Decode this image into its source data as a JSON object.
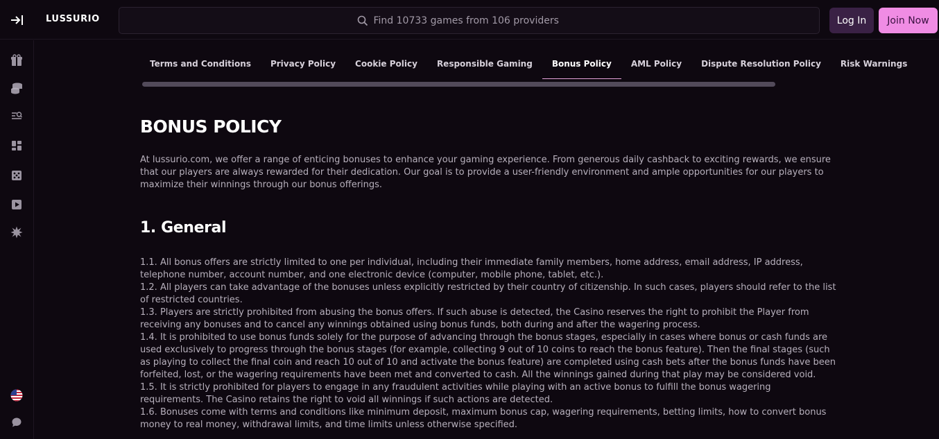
{
  "header": {
    "logo": "LUSSURIO",
    "search_placeholder": "Find 10733 games from 106 providers",
    "login_label": "Log In",
    "join_label": "Join Now"
  },
  "sidebar": {
    "icons": [
      "gift-icon",
      "coins-icon",
      "search-list-icon",
      "grid-icon",
      "dice-icon",
      "play-icon",
      "burst-icon",
      "us-flag-icon",
      "chat-icon"
    ]
  },
  "tabs": [
    {
      "label": "Terms and Conditions",
      "active": false
    },
    {
      "label": "Privacy Policy",
      "active": false
    },
    {
      "label": "Cookie Policy",
      "active": false
    },
    {
      "label": "Responsible Gaming",
      "active": false
    },
    {
      "label": "Bonus Policy",
      "active": true
    },
    {
      "label": "AML Policy",
      "active": false
    },
    {
      "label": "Dispute Resolution Policy",
      "active": false
    },
    {
      "label": "Risk Warnings",
      "active": false
    }
  ],
  "content": {
    "title": "BONUS POLICY",
    "intro": "At lussurio.com, we offer a range of enticing bonuses to enhance your gaming experience. From generous daily cashback to exciting rewards, we ensure that our players are always rewarded for their dedication. Our goal is to provide a user-friendly environment and ample opportunities for our players to maximize their winnings through our bonus offerings.",
    "section_title": "1. General",
    "clauses": [
      "1.1. All bonus offers are strictly limited to one per individual, including their immediate family members, home address, email address, IP address, telephone number, account number, and one electronic device (computer, mobile phone, tablet, etc.).",
      "1.2. All players can take advantage of the bonuses unless explicitly restricted by their country of citizenship. In such cases, players should refer to the list of restricted countries.",
      "1.3. Players are strictly prohibited from abusing the bonus offers. If such abuse is detected, the Casino reserves the right to prohibit the Player from receiving any bonuses and to cancel any winnings obtained using bonus funds, both during and after the wagering process.",
      "1.4. It is prohibited to use bonus funds solely for the purpose of advancing through the bonus stages, especially in cases where bonus or cash funds are used exclusively to progress through the bonus stages (for example, collecting 9 out of 10 coins to reach the bonus feature). Then the final stages (such as playing to collect the final coin and reach 10 out of 10 and activate the bonus feature) are completed using cash bets after the bonus funds have been forfeited, lost, or the wagering requirements have been met and converted to cash. All the winnings gained during that play may be considered void.",
      "1.5. It is strictly prohibited for players to engage in any fraudulent activities while playing with an active bonus to fulfill the bonus wagering requirements. The Casino retains the right to void all winnings if such actions are detected.",
      "1.6. Bonuses come with terms and conditions like minimum deposit, maximum bonus cap, wagering requirements, betting limits, how to convert bonus money to real money, withdrawal limits, and time limits unless otherwise specified."
    ]
  },
  "colors": {
    "background": "#0e0810",
    "join_button": "#f08ce4",
    "login_button": "#3a2145",
    "active_tab_underline": "#e6a3da"
  }
}
